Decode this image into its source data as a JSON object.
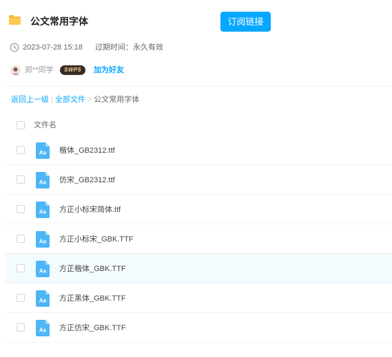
{
  "share": {
    "title": "公文常用字体",
    "subscribe_label": "订阅链接",
    "date": "2023-07-28 15:18",
    "expire": "过期时间：永久有效"
  },
  "user": {
    "name": "郑**同学",
    "vip_badge": "SWP5",
    "add_friend_label": "加为好友"
  },
  "breadcrumb": {
    "back": "返回上一级",
    "separator": "|",
    "all_files": "全部文件",
    "arrow": ">",
    "current": "公文常用字体"
  },
  "list": {
    "column_header": "文件名",
    "file_icon_text": "Aa",
    "files": [
      {
        "name": "楷体_GB2312.ttf"
      },
      {
        "name": "仿宋_GB2312.ttf"
      },
      {
        "name": "方正小标宋简体.ttf"
      },
      {
        "name": "方正小标宋_GBK.TTF"
      },
      {
        "name": "方正楷体_GBK.TTF"
      },
      {
        "name": "方正黑体_GBK.TTF"
      },
      {
        "name": "方正仿宋_GBK.TTF"
      }
    ]
  },
  "colors": {
    "accent": "#06a7ff",
    "row_highlight": "#f4fbff",
    "file_icon": "#4db6f7"
  }
}
